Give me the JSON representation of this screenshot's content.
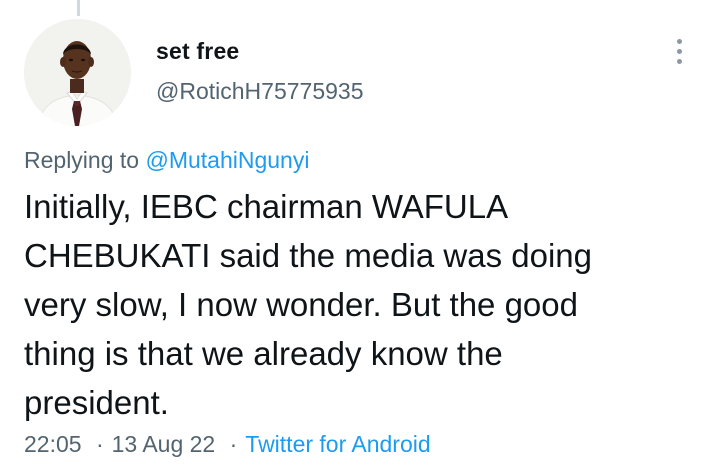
{
  "tweet": {
    "author": {
      "display_name": "set free",
      "handle": "@RotichH75775935",
      "avatar_icon": "profile-photo"
    },
    "more_icon": "three-dots-vertical-icon",
    "replying_to": {
      "prefix": "Replying to",
      "mention": "@MutahiNgunyi"
    },
    "text_lines": [
      "Initially, IEBC chairman WAFULA",
      "CHEBUKATI said the media was doing",
      "very slow, I now wonder. But the good",
      "thing is that we already know the",
      "president."
    ],
    "time": "22:05",
    "separator": "·",
    "date": "13 Aug 22",
    "source": "Twitter for Android"
  },
  "colors": {
    "text": "#0f1419",
    "secondary": "#536471",
    "link": "#1d9bf0"
  }
}
